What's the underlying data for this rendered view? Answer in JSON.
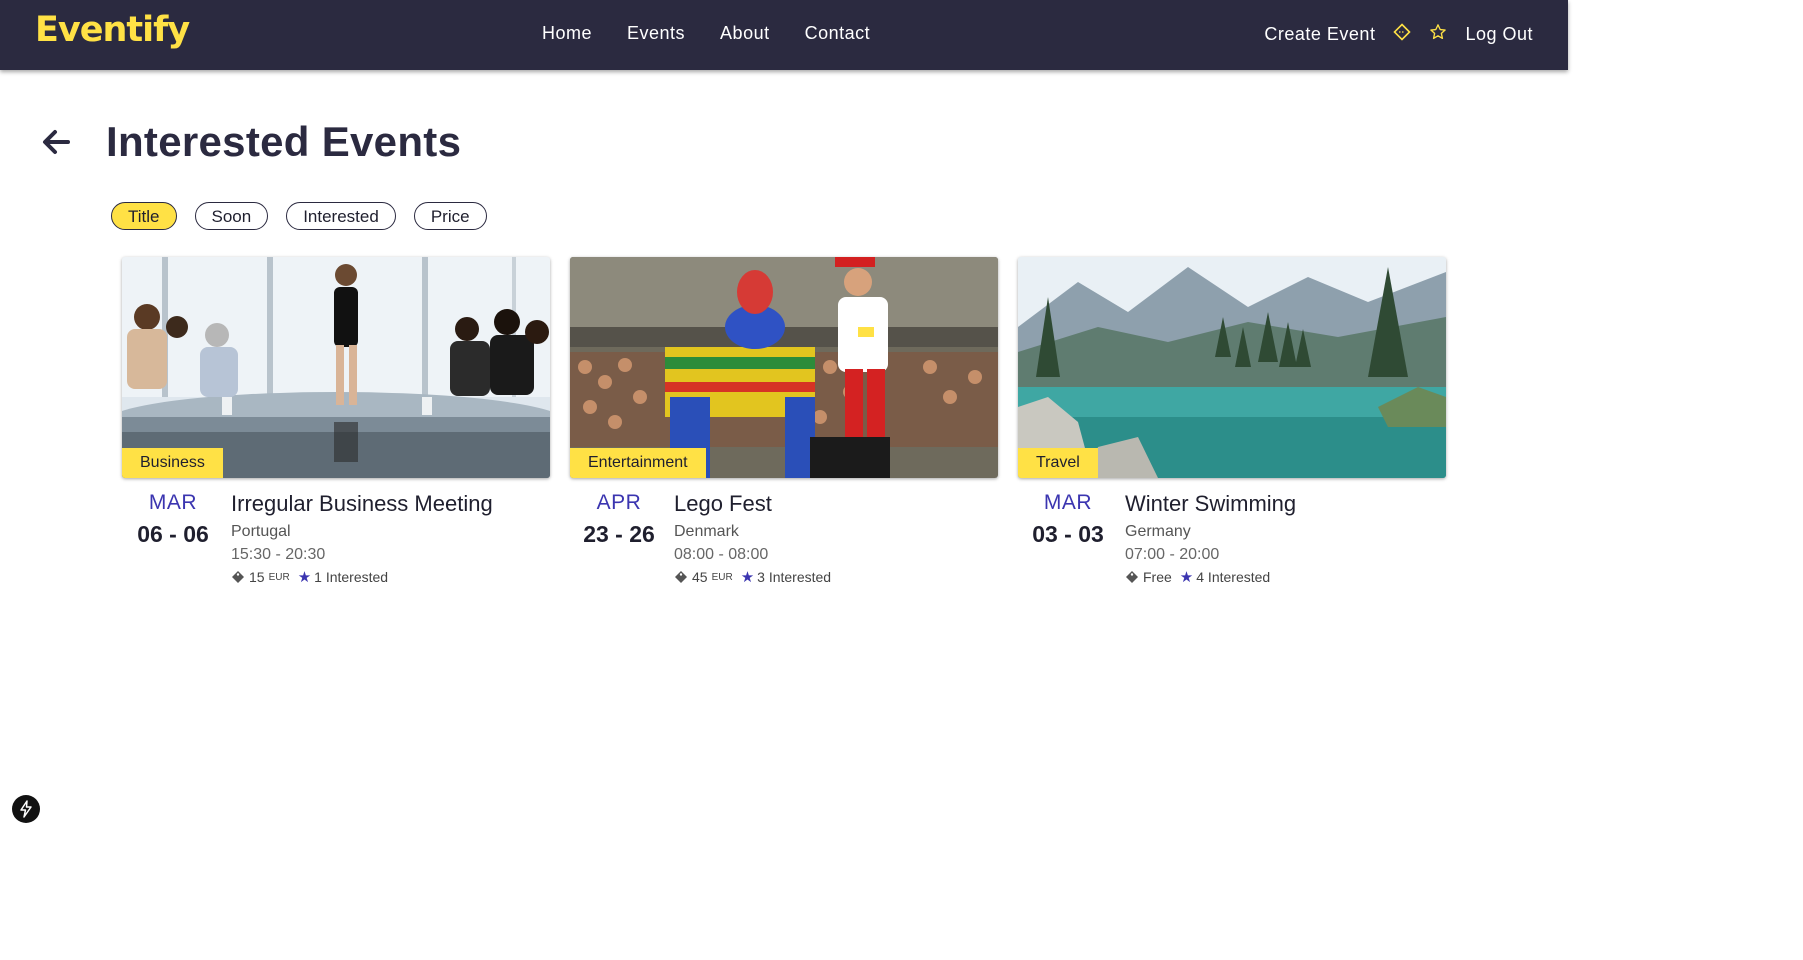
{
  "brand": {
    "name": "Eventify",
    "accent": "#ffe145",
    "nav_bg": "#2b2a40",
    "date_color": "#3b35b0"
  },
  "nav": {
    "links": [
      "Home",
      "Events",
      "About",
      "Contact"
    ],
    "create_event": "Create Event",
    "ticket_icon": "ticket-icon",
    "star_icon": "star-outline-icon",
    "logout": "Log Out"
  },
  "page": {
    "title": "Interested Events",
    "back_icon": "arrow-left-icon"
  },
  "filters": [
    {
      "label": "Title",
      "active": true
    },
    {
      "label": "Soon",
      "active": false
    },
    {
      "label": "Interested",
      "active": false
    },
    {
      "label": "Price",
      "active": false
    }
  ],
  "events": [
    {
      "category": "Business",
      "month": "MAR",
      "days": "06 - 06",
      "title": "Irregular Business Meeting",
      "country": "Portugal",
      "time": "15:30  - 20:30",
      "price": "15",
      "currency": "EUR",
      "interested": "1 Interested"
    },
    {
      "category": "Entertainment",
      "month": "APR",
      "days": "23 - 26",
      "title": "Lego Fest",
      "country": "Denmark",
      "time": "08:00  - 08:00",
      "price": "45",
      "currency": "EUR",
      "interested": "3 Interested"
    },
    {
      "category": "Travel",
      "month": "MAR",
      "days": "03 - 03",
      "title": "Winter Swimming",
      "country": "Germany",
      "time": "07:00  - 20:00",
      "price": "Free",
      "currency": "",
      "interested": "4 Interested"
    }
  ],
  "fab_icon": "lightning-icon"
}
